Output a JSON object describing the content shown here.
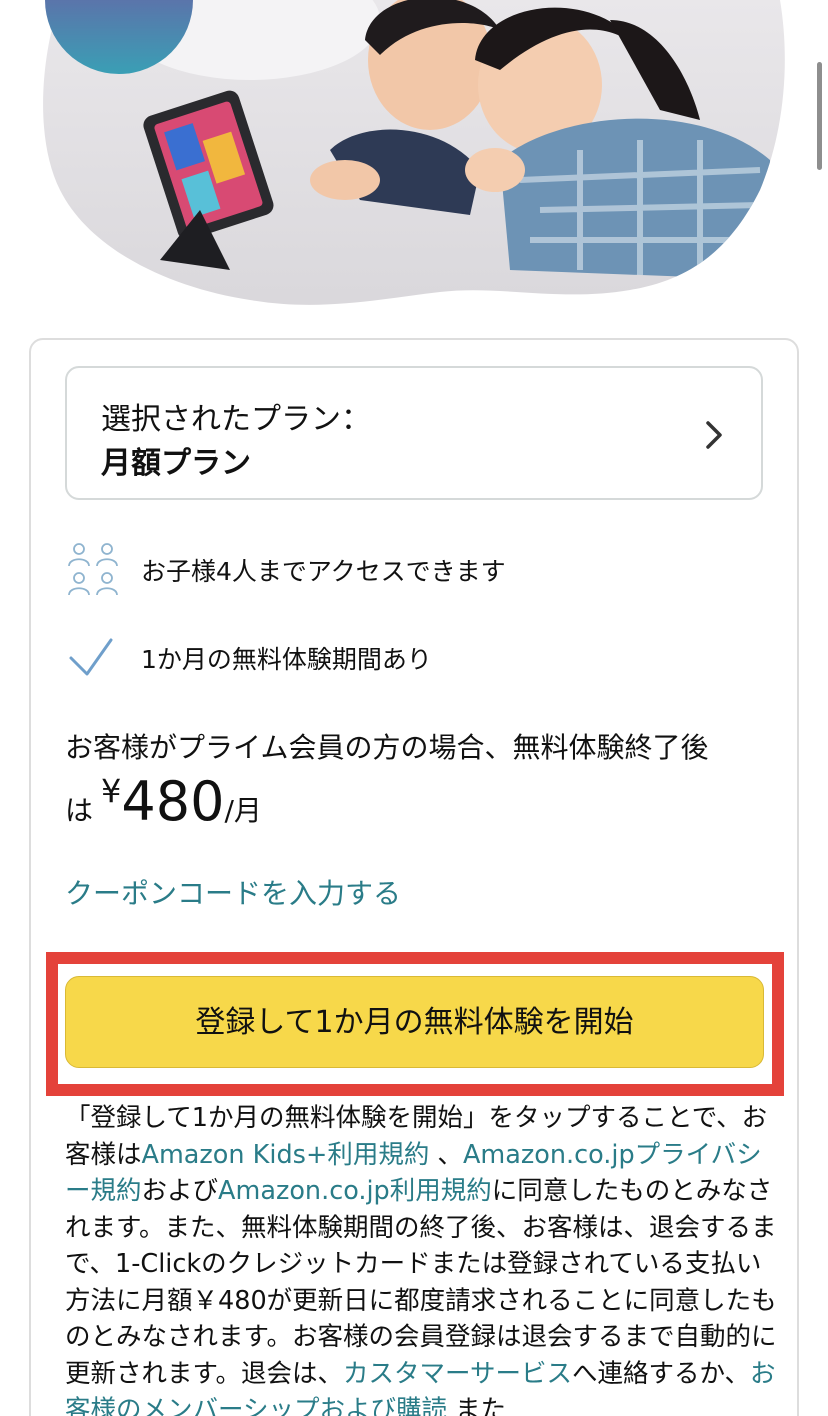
{
  "plan": {
    "label": "選択されたプラン：",
    "value": "月額プラン"
  },
  "features": [
    {
      "icon": "people-icon",
      "text": "お子様4人までアクセスできます"
    },
    {
      "icon": "check-icon",
      "text": "1か月の無料体験期間あり"
    }
  ],
  "price": {
    "line1": "お客様がプライム会員の方の場合、無料体験終了後",
    "prefix": "は",
    "currency": "¥",
    "amount": "480",
    "per": "/月"
  },
  "coupon_link": "クーポンコードを入力する",
  "cta": {
    "label": "登録して1か月の無料体験を開始"
  },
  "legal": {
    "t1": "「登録して1か月の無料体験を開始」をタップすることで、お客様は",
    "link_kids_terms": "Amazon Kids+利用規約",
    "t2": " 、",
    "link_privacy": "Amazon.co.jpプライバシー規約",
    "t3": "および",
    "link_terms": "Amazon.co.jp利用規約",
    "t4": "に同意したものとみなされます。また、無料体験期間の終了後、お客様は、退会するまで、1-Clickのクレジットカードまたは登録されている支払い方法に月額￥480が更新日に都度請求されることに同意したものとみなされます。お客様の会員登録は退会するまで自動的に更新されます。退会は、",
    "link_cs": "カスタマーサービス",
    "t5": "へ連絡するか、",
    "link_membership": "お客様のメンバーシップおよび購読",
    "t6": " また"
  },
  "colors": {
    "link": "#2a7c88",
    "cta_bg": "#f7d84a",
    "highlight": "#e4423a"
  }
}
